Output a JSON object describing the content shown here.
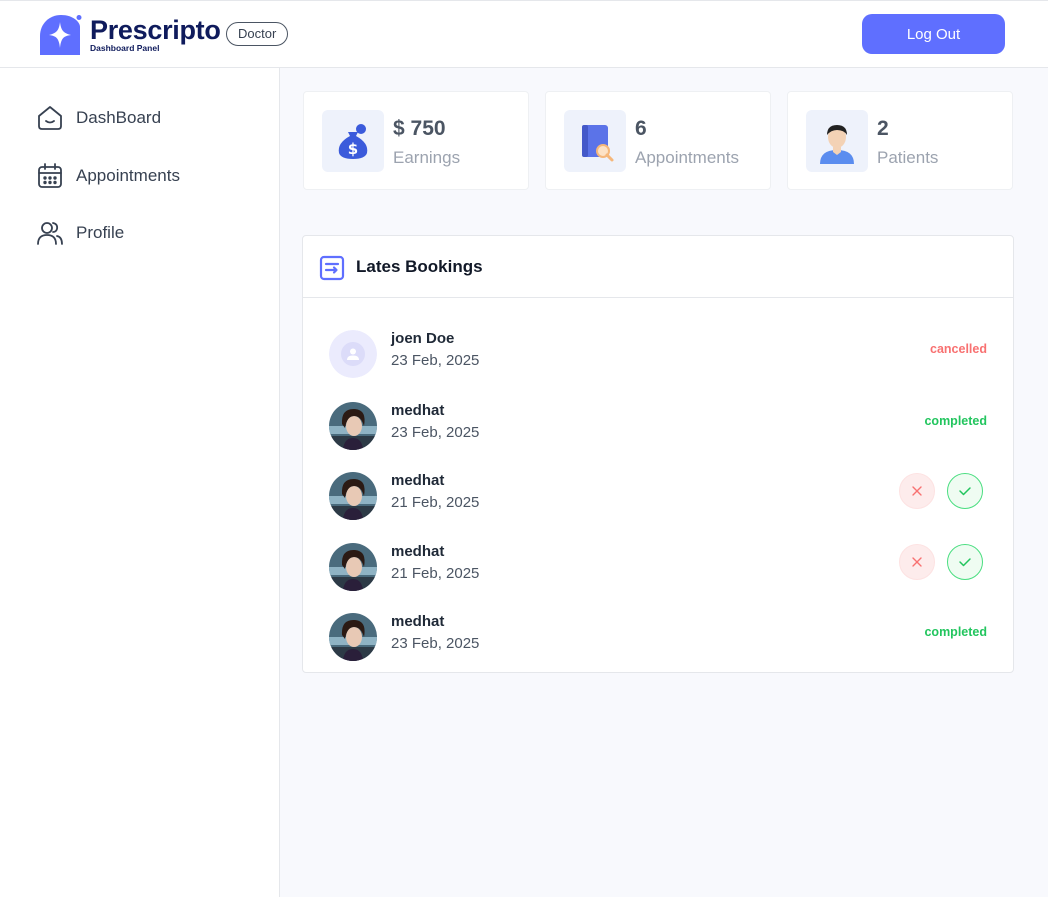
{
  "header": {
    "brand_name": "Prescripto",
    "brand_sub": "Dashboard Panel",
    "role_badge": "Doctor",
    "logout_label": "Log Out"
  },
  "sidebar": {
    "items": [
      {
        "label": "DashBoard",
        "icon": "home-icon"
      },
      {
        "label": "Appointments",
        "icon": "calendar-icon"
      },
      {
        "label": "Profile",
        "icon": "people-icon"
      }
    ]
  },
  "stats": [
    {
      "value": "$ 750",
      "label": "Earnings",
      "icon": "money-bag-icon"
    },
    {
      "value": "6",
      "label": "Appointments",
      "icon": "appointment-book-icon"
    },
    {
      "value": "2",
      "label": "Patients",
      "icon": "patient-icon"
    }
  ],
  "bookings": {
    "title": "Lates Bookings",
    "rows": [
      {
        "name": "joen Doe",
        "date": "23 Feb, 2025",
        "status": "cancelled",
        "avatar": "placeholder"
      },
      {
        "name": "medhat",
        "date": "23 Feb, 2025",
        "status": "completed",
        "avatar": "photo"
      },
      {
        "name": "medhat",
        "date": "21 Feb, 2025",
        "status": "",
        "avatar": "photo"
      },
      {
        "name": "medhat",
        "date": "21 Feb, 2025",
        "status": "",
        "avatar": "photo"
      },
      {
        "name": "medhat",
        "date": "23 Feb, 2025",
        "status": "completed",
        "avatar": "photo"
      }
    ]
  },
  "colors": {
    "primary": "#5f6fff",
    "cancelled": "#f87171",
    "completed": "#22c55e"
  }
}
